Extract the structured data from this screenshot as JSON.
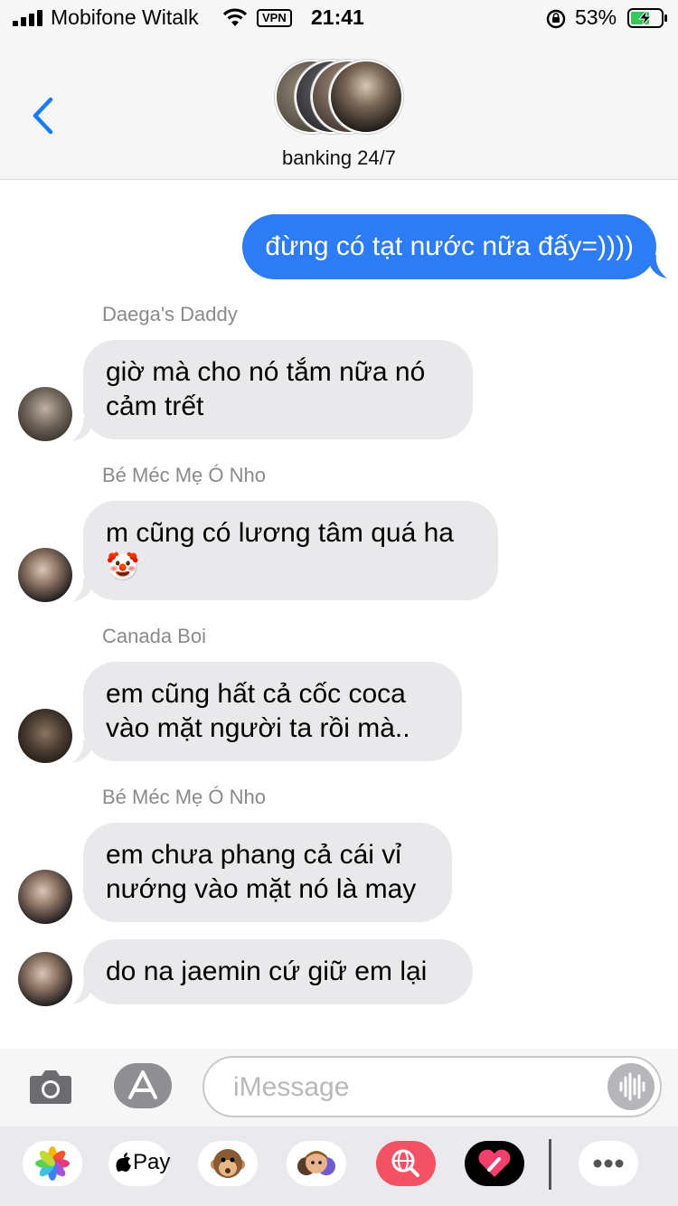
{
  "status_bar": {
    "carrier": "Mobifone Witalk",
    "vpn_label": "VPN",
    "time": "21:41",
    "battery_percent": "53%",
    "icons": [
      "signal-icon",
      "wifi-icon",
      "rotation-lock-icon",
      "battery-charging-icon"
    ]
  },
  "header": {
    "back_icon": "chevron-left-icon",
    "group_name": "banking 24/7"
  },
  "messages": [
    {
      "direction": "outgoing",
      "text": "đừng có tạt nước nữa đấy=))))"
    },
    {
      "direction": "incoming",
      "sender": "Daega's Daddy",
      "line1": "giờ mà cho nó tắm nữa nó",
      "line2": "cảm trết"
    },
    {
      "direction": "incoming",
      "sender": "Bé Méc Mẹ Ó Nho",
      "line1": "m cũng có lương tâm quá ha",
      "emoji": "🤡"
    },
    {
      "direction": "incoming",
      "sender": "Canada Boi",
      "line1": "em cũng hất cả cốc coca",
      "line2": "vào mặt người ta rồi mà.."
    },
    {
      "direction": "incoming",
      "sender": "Bé Méc Mẹ Ó Nho",
      "line1": "em chưa phang cả cái vỉ",
      "line2": "nướng vào mặt nó là may"
    },
    {
      "direction": "incoming",
      "line1": "do na jaemin cứ giữ em lại"
    }
  ],
  "input_bar": {
    "placeholder": "iMessage",
    "icons": [
      "camera-icon",
      "app-store-icon",
      "audio-waveform-icon"
    ]
  },
  "app_strip": {
    "apple_pay_label": "Pay",
    "apps": [
      "photos-icon",
      "apple-pay-icon",
      "monkey-animoji-icon",
      "memoji-icon",
      "web-search-icon",
      "digital-touch-icon",
      "more-icon"
    ]
  },
  "colors": {
    "outgoing_bubble": "#2d7cf6",
    "incoming_bubble": "#e9e9eb",
    "sender_label": "#8a8a8e"
  }
}
